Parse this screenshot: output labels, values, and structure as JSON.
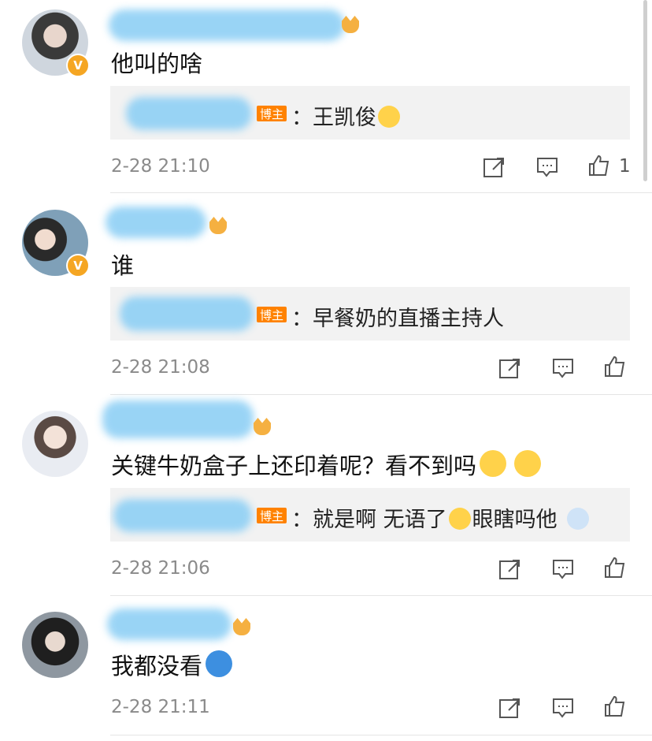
{
  "comments": [
    {
      "text": "他叫的啥",
      "reply": {
        "tag": "博主",
        "text": "：王凯俊"
      },
      "time": "2-28 21:10",
      "likes": "1"
    },
    {
      "text": "谁",
      "reply": {
        "tag": "博主",
        "text": "：早餐奶的直播主持人"
      },
      "time": "2-28 21:08"
    },
    {
      "text": "关键牛奶盒子上还印着呢？看不到吗",
      "reply": {
        "tag": "博主",
        "text": "：就是啊 无语了",
        "text2": "眼瞎吗他"
      },
      "time": "2-28 21:06"
    },
    {
      "text": "我都没看",
      "time": "2-28 21:11"
    }
  ],
  "badge_verified": "V",
  "colors": {
    "tag_bg": "#ff8200",
    "verified": "#f5a623"
  }
}
